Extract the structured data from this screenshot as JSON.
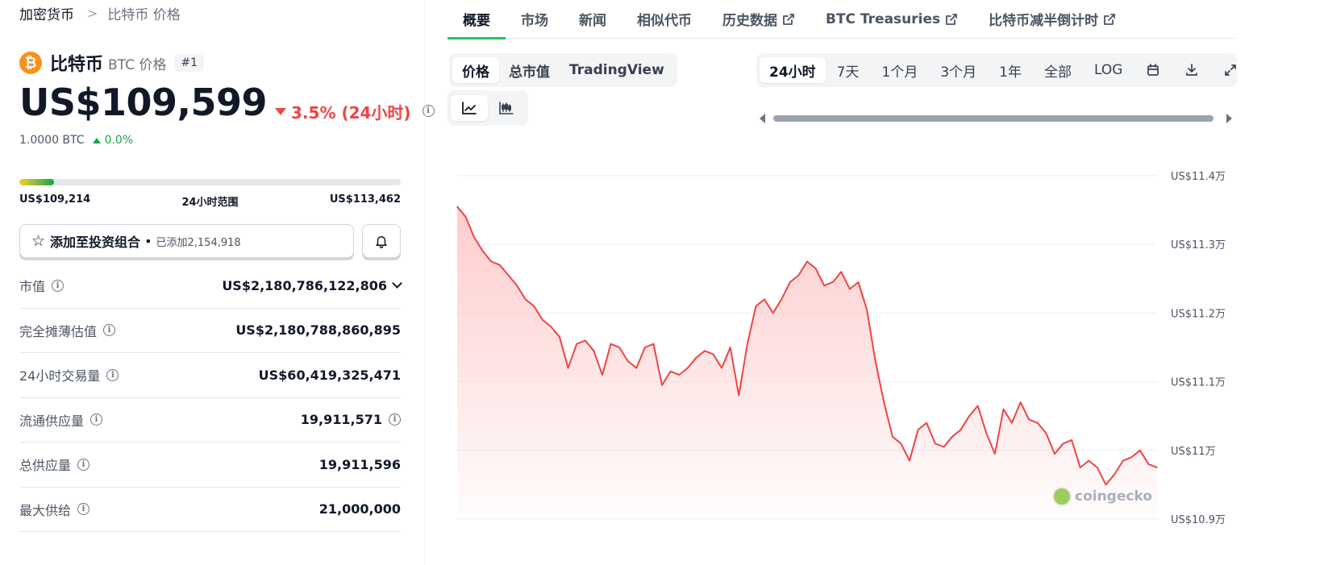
{
  "breadcrumb": {
    "parent": "加密货币",
    "current": "比特币 价格"
  },
  "coin": {
    "logo_glyph": "₿",
    "name": "比特币",
    "subtitle": "BTC 价格",
    "rank": "#1",
    "brand_color": "#f7931a"
  },
  "price": {
    "value": "US$109,599",
    "change": "3.5% (24小时)",
    "change_color": "#ef4444"
  },
  "btc": {
    "amount": "1.0000 BTC",
    "change": "0.0%",
    "change_color": "#16a34a"
  },
  "range": {
    "low": "US$109,214",
    "label": "24小时范围",
    "high": "US$113,462",
    "position_fraction": 0.09
  },
  "portfolio": {
    "label": "添加至投资组合",
    "dot": "•",
    "count": "已添加2,154,918"
  },
  "stats": [
    {
      "label": "市值",
      "value": "US$2,180,786,122,806",
      "has_info": true,
      "has_chevron": true
    },
    {
      "label": "完全摊薄估值",
      "value": "US$2,180,788,860,895",
      "has_info": true
    },
    {
      "label": "24小时交易量",
      "value": "US$60,419,325,471",
      "has_info": true
    },
    {
      "label": "流通供应量",
      "value": "19,911,571",
      "has_info": true,
      "value_info": true
    },
    {
      "label": "总供应量",
      "value": "19,911,596",
      "has_info": true
    },
    {
      "label": "最大供给",
      "value": "21,000,000",
      "has_info": true
    }
  ],
  "tabs": [
    {
      "label": "概要",
      "active": true
    },
    {
      "label": "市场"
    },
    {
      "label": "新闻"
    },
    {
      "label": "相似代币"
    },
    {
      "label": "历史数据",
      "external": true
    },
    {
      "label": "BTC Treasuries",
      "external": true
    },
    {
      "label": "比特币减半倒计时",
      "external": true
    }
  ],
  "chart_modes": [
    {
      "label": "价格",
      "active": true
    },
    {
      "label": "总市值"
    },
    {
      "label": "TradingView"
    }
  ],
  "chart_styles": [
    {
      "icon": "line-chart-icon",
      "active": true
    },
    {
      "icon": "candlestick-icon"
    }
  ],
  "time_ranges": [
    {
      "label": "24小时",
      "active": true
    },
    {
      "label": "7天"
    },
    {
      "label": "1个月"
    },
    {
      "label": "3个月"
    },
    {
      "label": "1年"
    },
    {
      "label": "全部"
    },
    {
      "label": "LOG"
    }
  ],
  "toolbar_icons": [
    "calendar-icon",
    "download-icon",
    "expand-icon"
  ],
  "watermark": "coingecko",
  "chart_data": {
    "type": "area",
    "title": "",
    "ylabel": "",
    "ylim": [
      109000,
      114000
    ],
    "yticks": [
      114000,
      113000,
      112000,
      111000,
      110000,
      109000
    ],
    "ytick_labels": [
      "US$11.4万",
      "US$11.3万",
      "US$11.2万",
      "US$11.1万",
      "US$11万",
      "US$10.9万"
    ],
    "line_color": "#ef4444",
    "fill_color": "#fecaca",
    "grid": true,
    "series": [
      {
        "values": [
          113550,
          113400,
          113100,
          112900,
          112750,
          112700,
          112550,
          112400,
          112200,
          112100,
          111900,
          111800,
          111650,
          111200,
          111550,
          111600,
          111450,
          111100,
          111550,
          111500,
          111300,
          111200,
          111500,
          111550,
          110950,
          111150,
          111100,
          111200,
          111350,
          111450,
          111400,
          111200,
          111500,
          110800,
          111550,
          112100,
          112200,
          112000,
          112200,
          112450,
          112550,
          112750,
          112650,
          112400,
          112450,
          112600,
          112350,
          112450,
          112050,
          111300,
          110700,
          110200,
          110100,
          109850,
          110300,
          110400,
          110100,
          110050,
          110200,
          110300,
          110500,
          110650,
          110250,
          109950,
          110600,
          110400,
          110700,
          110450,
          110400,
          110250,
          109950,
          110100,
          110150,
          109750,
          109850,
          109750,
          109500,
          109650,
          109850,
          109900,
          110000,
          109800,
          109750
        ]
      }
    ]
  }
}
